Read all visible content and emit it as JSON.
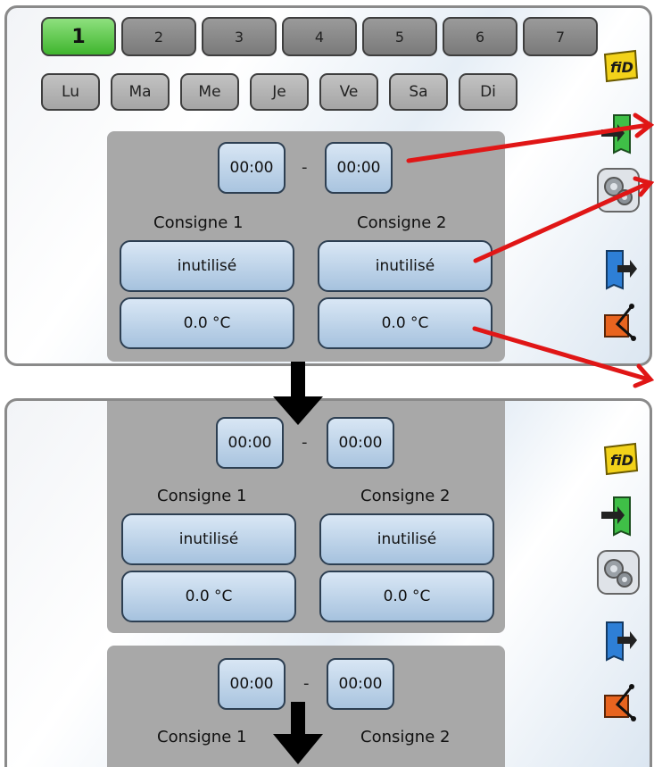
{
  "tabs": [
    "1",
    "2",
    "3",
    "4",
    "5",
    "6",
    "7"
  ],
  "days": [
    "Lu",
    "Ma",
    "Me",
    "Je",
    "Ve",
    "Sa",
    "Di"
  ],
  "time_start": "00:00",
  "time_end": "00:00",
  "separator": "-",
  "setpoint1_label": "Consigne 1",
  "setpoint2_label": "Consigne 2",
  "setpoint1_mode": "inutilisé",
  "setpoint2_mode": "inutilisé",
  "setpoint1_temp": "0.0 °C",
  "setpoint2_temp": "0.0 °C",
  "sidebar_fid_text": "fiD",
  "sidebar_icons": [
    "fid-icon",
    "input-icon",
    "settings-gears-icon",
    "output-icon",
    "function-module-icon"
  ],
  "colors": {
    "active_tab": "#3fb52e",
    "arrow": "#e01616",
    "field": "#a9c4df"
  }
}
